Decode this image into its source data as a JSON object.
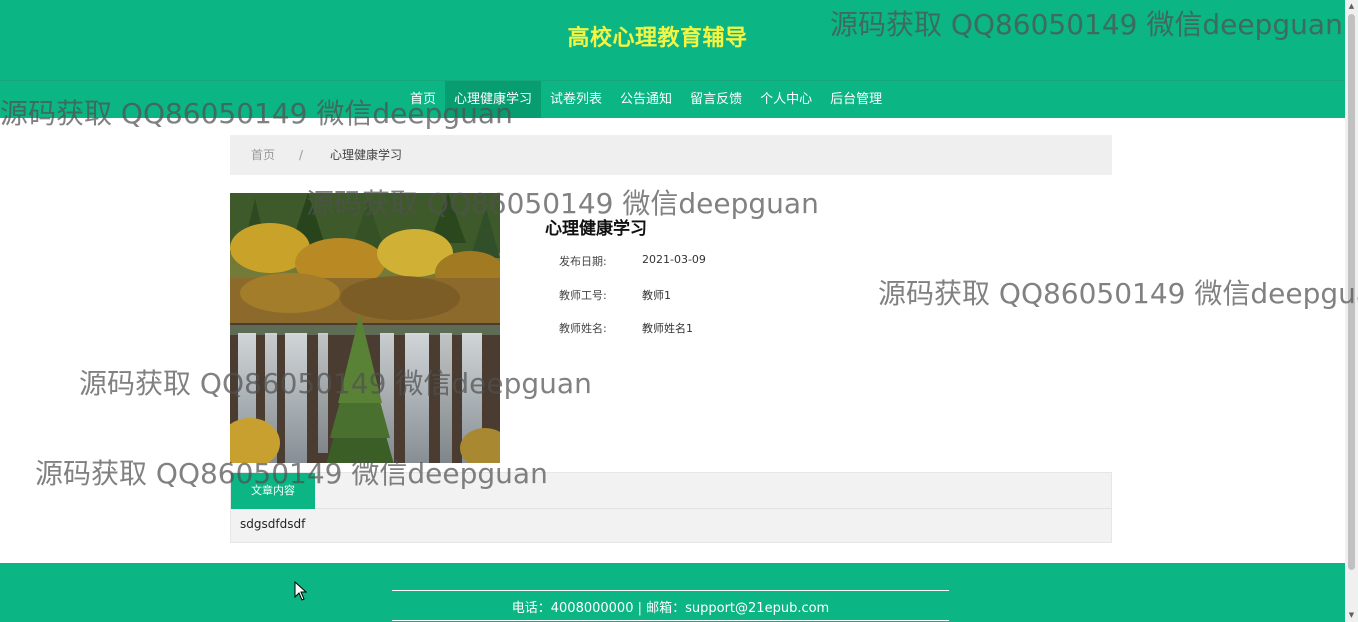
{
  "header": {
    "site_title": "高校心理教育辅导"
  },
  "nav": {
    "items": [
      {
        "label": "首页"
      },
      {
        "label": "心理健康学习",
        "active": true
      },
      {
        "label": "试卷列表"
      },
      {
        "label": "公告通知"
      },
      {
        "label": "留言反馈"
      },
      {
        "label": "个人中心"
      },
      {
        "label": "后台管理"
      }
    ]
  },
  "breadcrumb": {
    "home": "首页",
    "separator": "/",
    "current": "心理健康学习"
  },
  "detail": {
    "title": "心理健康学习",
    "fields": [
      {
        "label": "发布日期:",
        "value": "2021-03-09"
      },
      {
        "label": "教师工号:",
        "value": "教师1"
      },
      {
        "label": "教师姓名:",
        "value": "教师姓名1"
      }
    ]
  },
  "content": {
    "tab_label": "文章内容",
    "text": "sdgsdfdsdf"
  },
  "footer": {
    "contact": "电话：4008000000 | 邮箱：support@21epub.com"
  },
  "watermark": {
    "text": "源码获取 QQ86050149 微信deepguan"
  },
  "colors": {
    "primary": "#0bb584",
    "title_yellow": "#f3f542",
    "nav_active": "#089c71"
  }
}
